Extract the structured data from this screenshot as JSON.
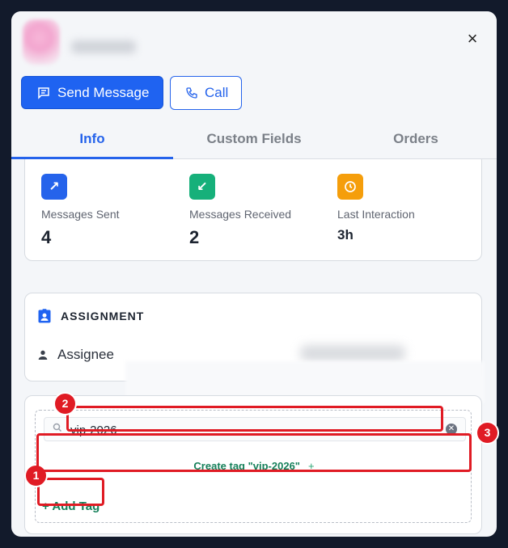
{
  "contact": {
    "close_label": "×"
  },
  "actions": {
    "send_message": "Send Message",
    "call": "Call"
  },
  "tabs": [
    {
      "label": "Info",
      "active": true
    },
    {
      "label": "Custom Fields",
      "active": false
    },
    {
      "label": "Orders",
      "active": false
    }
  ],
  "stats": [
    {
      "label": "Messages Sent",
      "value": "4",
      "icon": "arrow-up-right-icon",
      "color": "#2563eb"
    },
    {
      "label": "Messages Received",
      "value": "2",
      "icon": "arrow-down-left-icon",
      "color": "#16b07a"
    },
    {
      "label": "Last Interaction",
      "value": "3h",
      "icon": "clock-icon",
      "color": "#f59e0b"
    }
  ],
  "assignment": {
    "title": "ASSIGNMENT",
    "assignee_label": "Assignee"
  },
  "tags": {
    "search_value": "vip-2026",
    "create_option": "Create tag \"vip-2026\"",
    "create_plus": "+",
    "add_tag": "+ Add Tag"
  },
  "annotations": {
    "badge_1": "1",
    "badge_2": "2",
    "badge_3": "3"
  },
  "colors": {
    "accent": "#2563eb",
    "tag_green": "#15805a",
    "highlight": "#e01b24"
  }
}
